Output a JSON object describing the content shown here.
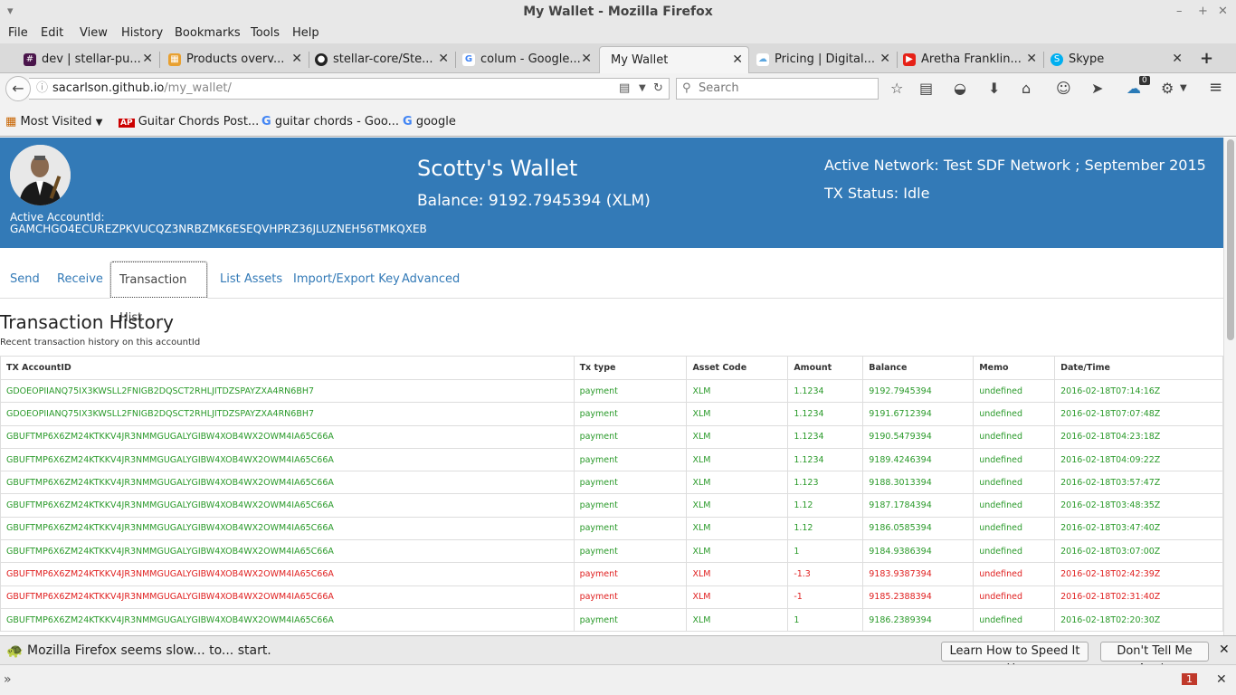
{
  "window": {
    "title": "My Wallet - Mozilla Firefox"
  },
  "menu": [
    "File",
    "Edit",
    "View",
    "History",
    "Bookmarks",
    "Tools",
    "Help"
  ],
  "tabs": [
    {
      "label": "dev | stellar-pu...",
      "icon": "slack-icon",
      "color": "#4a154b",
      "active": false
    },
    {
      "label": "Products overv...",
      "icon": "products-icon",
      "color": "#e8a030",
      "active": false
    },
    {
      "label": "stellar-core/Ste...",
      "icon": "github-icon",
      "color": "#222222",
      "active": false
    },
    {
      "label": "colum - Google...",
      "icon": "google-icon",
      "color": "#4285f4",
      "active": false
    },
    {
      "label": "My Wallet",
      "icon": "",
      "color": "",
      "active": true
    },
    {
      "label": "Pricing | Digital...",
      "icon": "cloud-icon",
      "color": "#5fa8e0",
      "active": false
    },
    {
      "label": "Aretha Franklin...",
      "icon": "youtube-icon",
      "color": "#e62117",
      "active": false
    },
    {
      "label": "Skype",
      "icon": "skype-icon",
      "color": "#00aff0",
      "active": false
    }
  ],
  "nav": {
    "url_domain": "sacarlson.github.io",
    "url_path": "/my_wallet/",
    "search_placeholder": "Search",
    "badge_count": "0"
  },
  "bookmarks": [
    {
      "label": "Most Visited",
      "icon": "most-visited-icon"
    },
    {
      "label": "Guitar Chords Post...",
      "icon": "ap-icon"
    },
    {
      "label": "guitar chords - Goo...",
      "icon": "google-icon"
    },
    {
      "label": "google",
      "icon": "google-icon"
    }
  ],
  "header": {
    "account_label": "Active AccountId:",
    "account_id": "GAMCHGO4ECUREZPKVUCQZ3NRBZMK6ESEQVHPRZ36JLUZNEH56TMKQXEB",
    "wallet_title": "Scotty's Wallet",
    "balance": "Balance: 9192.7945394 (XLM)",
    "network": "Active Network: Test SDF Network ; September 2015",
    "tx_status": "TX Status: Idle",
    "bg_color": "#337ab7"
  },
  "page_tabs": [
    "Send",
    "Receive",
    "Transaction Hist",
    "List Assets",
    "Import/Export Key",
    "Advanced"
  ],
  "history": {
    "title": "Transaction History",
    "subtitle": "Recent transaction history on this accountId",
    "columns": [
      "TX AccountID",
      "Tx type",
      "Asset Code",
      "Amount",
      "Balance",
      "Memo",
      "Date/Time"
    ],
    "rows": [
      {
        "id": "GDOEOPIIANQ75IX3KWSLL2FNIGB2DQSCT2RHLJITDZSPAYZXA4RN6BH7",
        "type": "payment",
        "asset": "XLM",
        "amount": "1.1234",
        "balance": "9192.7945394",
        "memo": "undefined",
        "date": "2016-02-18T07:14:16Z",
        "status": "pos"
      },
      {
        "id": "GDOEOPIIANQ75IX3KWSLL2FNIGB2DQSCT2RHLJITDZSPAYZXA4RN6BH7",
        "type": "payment",
        "asset": "XLM",
        "amount": "1.1234",
        "balance": "9191.6712394",
        "memo": "undefined",
        "date": "2016-02-18T07:07:48Z",
        "status": "pos"
      },
      {
        "id": "GBUFTMP6X6ZM24KTKKV4JR3NMMGUGALYGIBW4XOB4WX2OWM4IA65C66A",
        "type": "payment",
        "asset": "XLM",
        "amount": "1.1234",
        "balance": "9190.5479394",
        "memo": "undefined",
        "date": "2016-02-18T04:23:18Z",
        "status": "pos"
      },
      {
        "id": "GBUFTMP6X6ZM24KTKKV4JR3NMMGUGALYGIBW4XOB4WX2OWM4IA65C66A",
        "type": "payment",
        "asset": "XLM",
        "amount": "1.1234",
        "balance": "9189.4246394",
        "memo": "undefined",
        "date": "2016-02-18T04:09:22Z",
        "status": "pos"
      },
      {
        "id": "GBUFTMP6X6ZM24KTKKV4JR3NMMGUGALYGIBW4XOB4WX2OWM4IA65C66A",
        "type": "payment",
        "asset": "XLM",
        "amount": "1.123",
        "balance": "9188.3013394",
        "memo": "undefined",
        "date": "2016-02-18T03:57:47Z",
        "status": "pos"
      },
      {
        "id": "GBUFTMP6X6ZM24KTKKV4JR3NMMGUGALYGIBW4XOB4WX2OWM4IA65C66A",
        "type": "payment",
        "asset": "XLM",
        "amount": "1.12",
        "balance": "9187.1784394",
        "memo": "undefined",
        "date": "2016-02-18T03:48:35Z",
        "status": "pos"
      },
      {
        "id": "GBUFTMP6X6ZM24KTKKV4JR3NMMGUGALYGIBW4XOB4WX2OWM4IA65C66A",
        "type": "payment",
        "asset": "XLM",
        "amount": "1.12",
        "balance": "9186.0585394",
        "memo": "undefined",
        "date": "2016-02-18T03:47:40Z",
        "status": "pos"
      },
      {
        "id": "GBUFTMP6X6ZM24KTKKV4JR3NMMGUGALYGIBW4XOB4WX2OWM4IA65C66A",
        "type": "payment",
        "asset": "XLM",
        "amount": "1",
        "balance": "9184.9386394",
        "memo": "undefined",
        "date": "2016-02-18T03:07:00Z",
        "status": "pos"
      },
      {
        "id": "GBUFTMP6X6ZM24KTKKV4JR3NMMGUGALYGIBW4XOB4WX2OWM4IA65C66A",
        "type": "payment",
        "asset": "XLM",
        "amount": "-1.3",
        "balance": "9183.9387394",
        "memo": "undefined",
        "date": "2016-02-18T02:42:39Z",
        "status": "neg"
      },
      {
        "id": "GBUFTMP6X6ZM24KTKKV4JR3NMMGUGALYGIBW4XOB4WX2OWM4IA65C66A",
        "type": "payment",
        "asset": "XLM",
        "amount": "-1",
        "balance": "9185.2388394",
        "memo": "undefined",
        "date": "2016-02-18T02:31:40Z",
        "status": "neg"
      },
      {
        "id": "GBUFTMP6X6ZM24KTKKV4JR3NMMGUGALYGIBW4XOB4WX2OWM4IA65C66A",
        "type": "payment",
        "asset": "XLM",
        "amount": "1",
        "balance": "9186.2389394",
        "memo": "undefined",
        "date": "2016-02-18T02:20:30Z",
        "status": "pos"
      }
    ]
  },
  "notification": {
    "message": "Mozilla Firefox seems slow... to... start.",
    "learn_button": "Learn How to Speed It Up",
    "dismiss_button": "Don't Tell Me Again"
  },
  "bottom_badge": "1",
  "colors": {
    "positive": "#2a9a2a",
    "negative": "#e02020",
    "link": "#337ab7"
  }
}
